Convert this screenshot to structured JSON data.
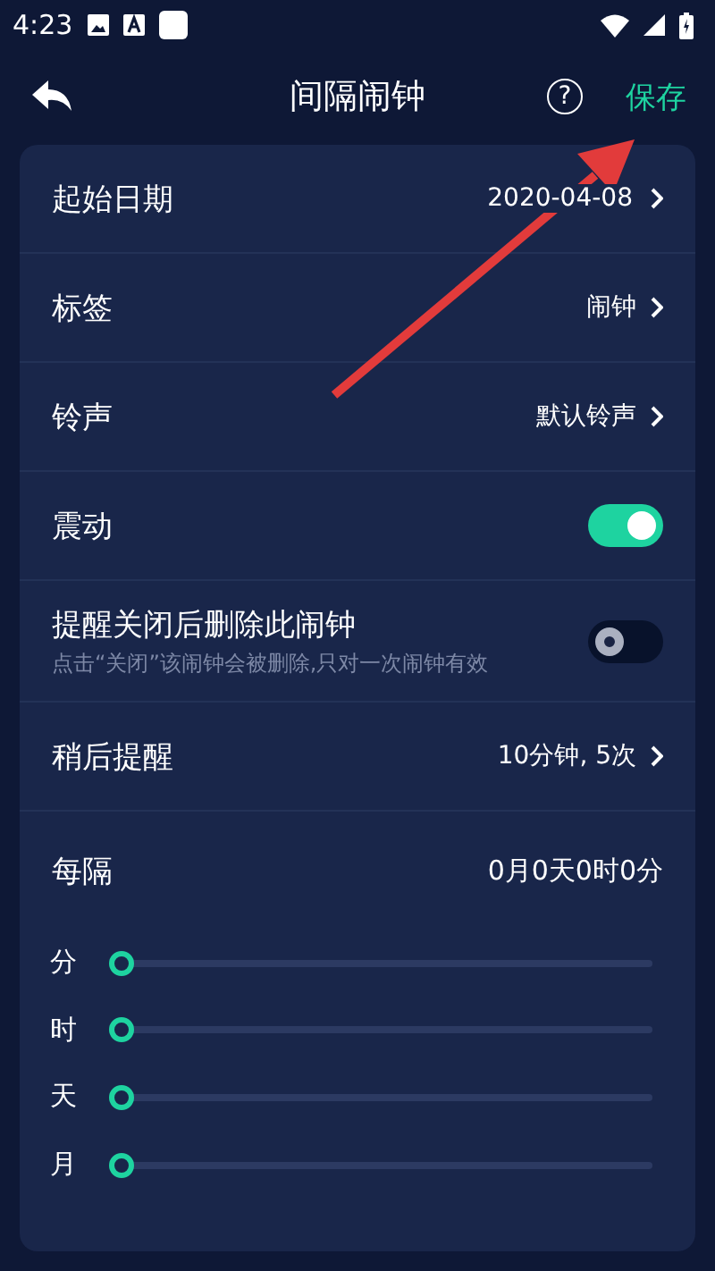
{
  "status_bar": {
    "time": "4:23"
  },
  "header": {
    "title": "间隔闹钟",
    "help_icon": "?",
    "save": "保存"
  },
  "rows": [
    {
      "kind": "link",
      "label": "起始日期",
      "value": "2020-04-08"
    },
    {
      "kind": "link",
      "label": "标签",
      "value": "闹钟"
    },
    {
      "kind": "link",
      "label": "铃声",
      "value": "默认铃声"
    },
    {
      "kind": "toggle",
      "label": "震动",
      "on": true
    },
    {
      "kind": "toggle",
      "label": "提醒关闭后删除此闹钟",
      "hint": "点击“关闭”该闹钟会被删除,只对一次闹钟有效",
      "on": false
    },
    {
      "kind": "link",
      "label": "稍后提醒",
      "value": "10分钟, 5次"
    }
  ],
  "interval": {
    "label": "每隔",
    "value": "0月0天0时0分",
    "sliders": [
      {
        "label": "分",
        "level": 0
      },
      {
        "label": "时",
        "level": 0
      },
      {
        "label": "天",
        "level": 0
      },
      {
        "label": "月",
        "level": 0
      }
    ]
  }
}
